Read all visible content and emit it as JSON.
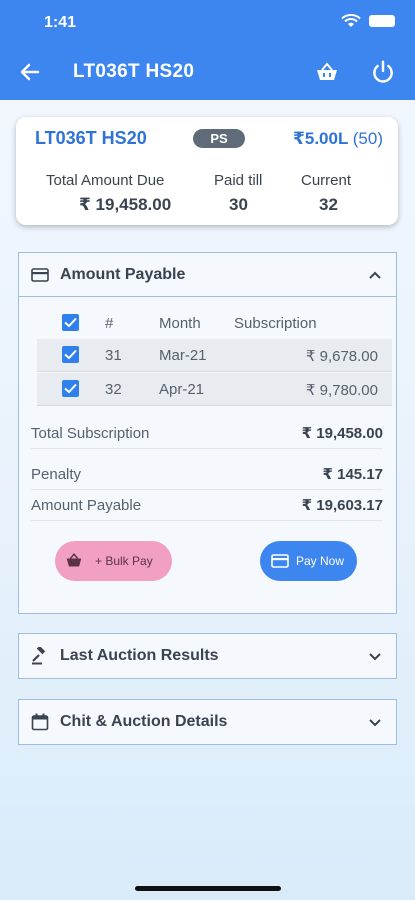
{
  "status_bar": {
    "time": "1:41",
    "icons": [
      "wifi-icon",
      "battery-icon"
    ]
  },
  "header": {
    "title": "LT036T HS20",
    "icons": [
      "back-arrow-icon",
      "basket-icon",
      "power-icon"
    ]
  },
  "summary": {
    "code": "LT036T HS20",
    "badge": "PS",
    "chit_value": "₹5.00L",
    "chit_count": "(50)",
    "total_due_label": "Total Amount Due",
    "total_due_value": "₹ 19,458.00",
    "paid_till_label": "Paid till",
    "paid_till_value": "30",
    "current_label": "Current",
    "current_value": "32"
  },
  "amount_payable": {
    "title": "Amount Payable",
    "expanded": true,
    "columns": [
      "#",
      "Month",
      "Subscription"
    ],
    "rows": [
      {
        "checked": true,
        "number": "31",
        "month": "Mar-21",
        "subscription": "₹ 9,678.00"
      },
      {
        "checked": true,
        "number": "32",
        "month": "Apr-21",
        "subscription": "₹ 9,780.00"
      }
    ],
    "total_subscription_label": "Total Subscription",
    "total_subscription_value": "₹ 19,458.00",
    "penalty_label": "Penalty",
    "penalty_value": "₹ 145.17",
    "amount_payable_label": "Amount Payable",
    "amount_payable_value": "₹ 19,603.17",
    "bulk_pay_label": "+ Bulk Pay",
    "pay_now_label": "Pay Now"
  },
  "last_auction": {
    "title": "Last Auction Results",
    "expanded": false
  },
  "chit_auction": {
    "title": "Chit & Auction Details",
    "expanded": false
  },
  "colors": {
    "primary": "#3d86f0",
    "accent_pink": "#f1a0c4",
    "badge": "#5f6b78",
    "link_blue": "#2f73d6"
  }
}
